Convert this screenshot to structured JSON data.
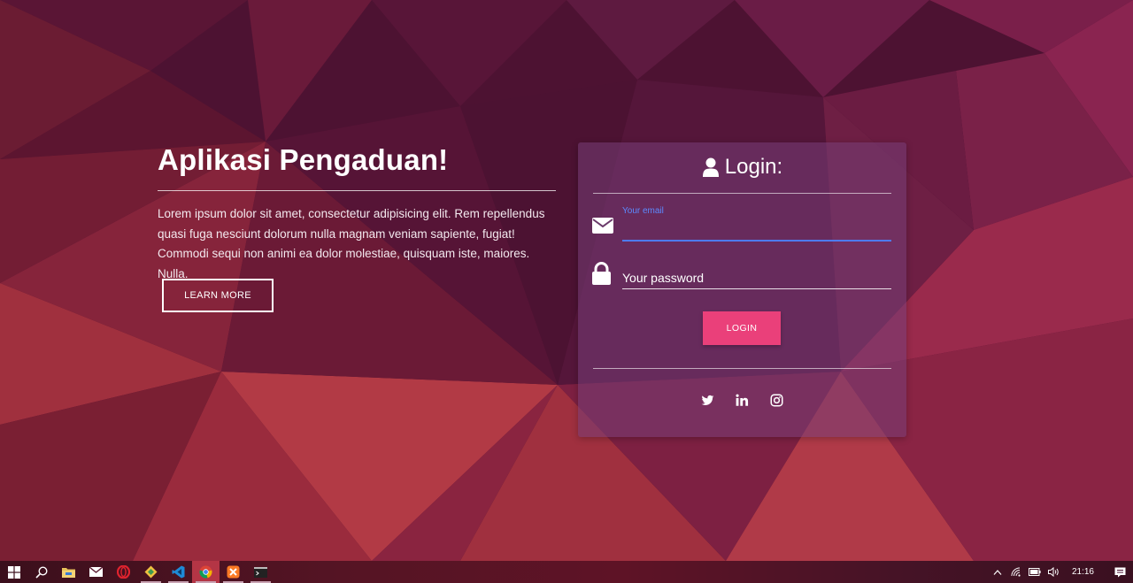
{
  "hero": {
    "title": "Aplikasi Pengaduan!",
    "description": "Lorem ipsum dolor sit amet, consectetur adipisicing elit. Rem repellendus quasi fuga nesciunt dolorum nulla magnam veniam sapiente, fugiat! Commodi sequi non animi ea dolor molestiae, quisquam iste, maiores. Nulla.",
    "learn_more_label": "LEARN MORE"
  },
  "login": {
    "title": "Login:",
    "email_label": "Your email",
    "email_value": "",
    "password_placeholder": "Your password",
    "password_value": "",
    "button_label": "LOGIN",
    "social": [
      "twitter-icon",
      "linkedin-icon",
      "instagram-icon"
    ]
  },
  "taskbar": {
    "apps": [
      "windows-start-icon",
      "search-icon",
      "file-explorer-icon",
      "mail-icon",
      "opera-icon",
      "git-icon",
      "vscode-icon",
      "chrome-icon",
      "xampp-icon",
      "terminal-icon"
    ],
    "tray": [
      "chevron-up-icon",
      "wifi-icon",
      "battery-icon",
      "volume-icon"
    ],
    "clock": "21:16",
    "notification_icon": "notification-icon"
  },
  "colors": {
    "accent": "#ea407a",
    "focus_blue": "#4d7bf3",
    "card_bg": "rgba(118,62,120,0.55)",
    "background": "#4a1030"
  }
}
